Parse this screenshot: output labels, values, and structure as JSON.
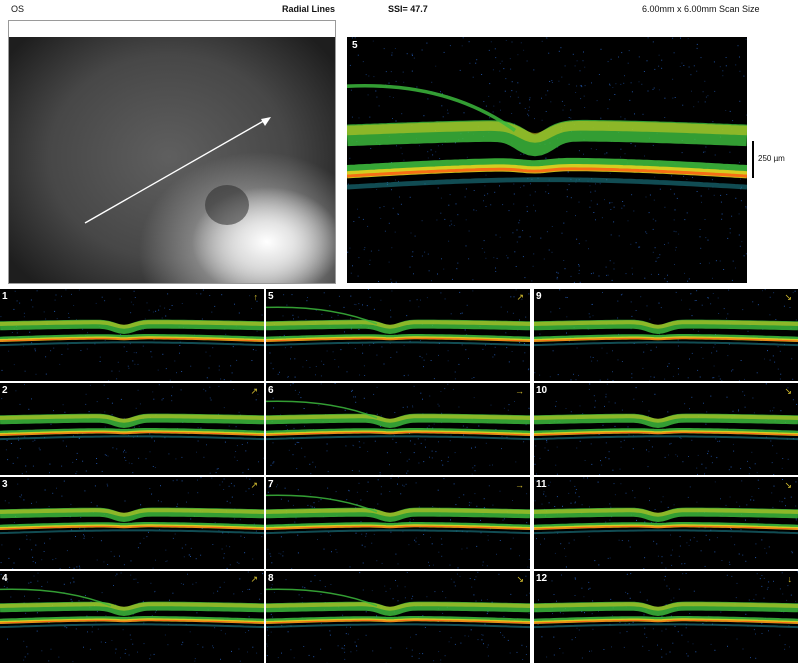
{
  "header": {
    "eye": "OS",
    "scan_type": "Radial Lines",
    "ssi": "SSI= 47.7",
    "scan_size": "6.00mm x 6.00mm Scan Size"
  },
  "main_scan": {
    "label": "5",
    "scale_text": "250 µm"
  },
  "thumbnails": [
    {
      "label": "1",
      "arrow": "↑"
    },
    {
      "label": "2",
      "arrow": "↗"
    },
    {
      "label": "3",
      "arrow": "↗"
    },
    {
      "label": "4",
      "arrow": "↗"
    },
    {
      "label": "5",
      "arrow": "↗"
    },
    {
      "label": "6",
      "arrow": "→"
    },
    {
      "label": "7",
      "arrow": "→"
    },
    {
      "label": "8",
      "arrow": "↘"
    },
    {
      "label": "9",
      "arrow": "↘"
    },
    {
      "label": "10",
      "arrow": "↘"
    },
    {
      "label": "11",
      "arrow": "↘"
    },
    {
      "label": "12",
      "arrow": "↓"
    }
  ],
  "colors": {
    "retina_green": "#3cb83c",
    "retina_yellow": "#e6d21e",
    "retina_orange": "#ff5a14",
    "arrow_yellow": "#d9c230"
  }
}
